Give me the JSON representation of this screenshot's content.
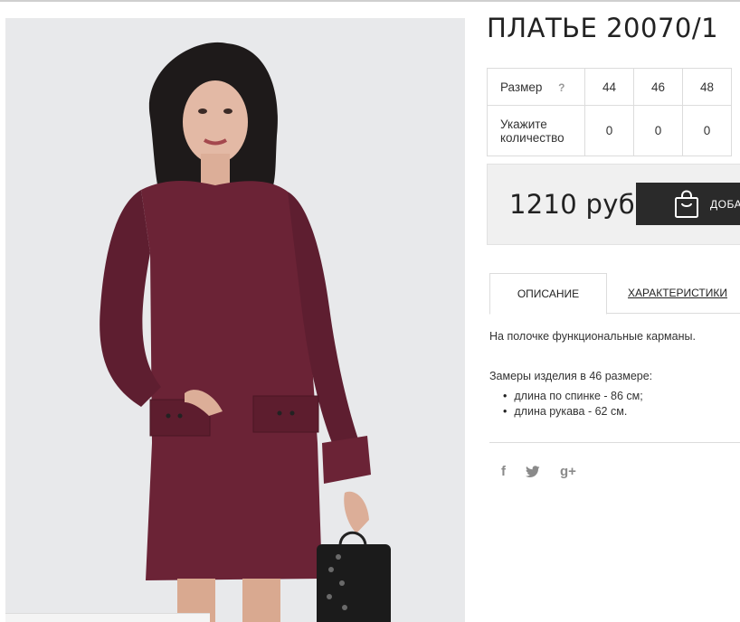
{
  "product": {
    "title": "ПЛАТЬЕ 20070/1",
    "image_alt": "Бордовое платье"
  },
  "size_table": {
    "size_label": "Размер",
    "help_icon": "?",
    "sizes": [
      "44",
      "46",
      "48"
    ],
    "quantity_label": "Укажите количество",
    "quantities": [
      "0",
      "0",
      "0"
    ]
  },
  "price": {
    "value": "1210 руб",
    "buy_label": "ДОБА"
  },
  "tabs": {
    "active": "ОПИСАНИЕ",
    "other": "ХАРАКТЕРИСТИКИ"
  },
  "description": {
    "text": "На полочке функциональные карманы.",
    "measure_title": "Замеры изделия в 46 размере:",
    "measures": [
      "длина по спинке - 86 см;",
      "длина рукава - 62 см."
    ]
  },
  "social": {
    "icons": [
      "facebook-icon",
      "twitter-icon",
      "google-plus-icon"
    ],
    "facebook": "f",
    "google_plus": "g+"
  },
  "colors": {
    "dress": "#6b2336",
    "button": "#2a2a2a",
    "price_bg": "#f0f0f0"
  }
}
